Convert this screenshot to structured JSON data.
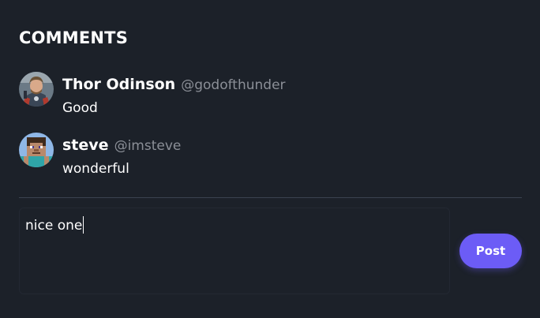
{
  "section": {
    "title": "COMMENTS"
  },
  "comments": [
    {
      "name": "Thor Odinson",
      "handle": "@godofthunder",
      "text": "Good",
      "avatar_icon": "thor-avatar-icon"
    },
    {
      "name": "steve",
      "handle": "@imsteve",
      "text": "wonderful",
      "avatar_icon": "minecraft-steve-avatar-icon"
    }
  ],
  "composer": {
    "value": "nice one",
    "placeholder": ""
  },
  "actions": {
    "post_label": "Post"
  },
  "colors": {
    "background": "#1c2129",
    "accent": "#6c5cf6",
    "handle": "#8b8f97",
    "divider": "#3b4250"
  }
}
